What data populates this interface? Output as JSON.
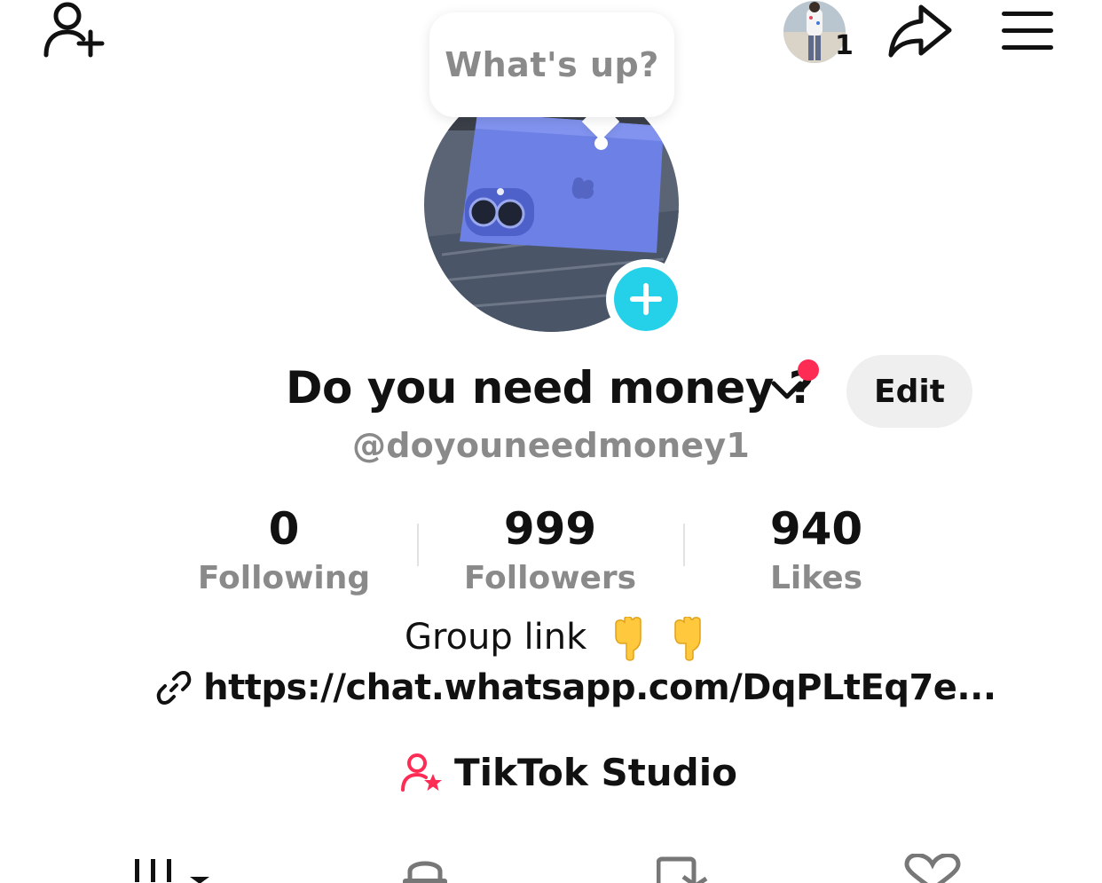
{
  "header": {
    "add_friend_icon": "add-user-icon",
    "notification_count": "1",
    "share_icon": "share-icon",
    "menu_icon": "hamburger-icon"
  },
  "bubble": {
    "text": "What's up?"
  },
  "profile": {
    "name": "Do you need money ?",
    "handle": "@doyouneedmoney1",
    "edit_label": "Edit"
  },
  "stats": [
    {
      "value": "0",
      "label": "Following"
    },
    {
      "value": "999",
      "label": "Followers"
    },
    {
      "value": "940",
      "label": "Likes"
    }
  ],
  "bio": {
    "line1": "Group link",
    "link": "https://chat.whatsapp.com/DqPLtEq7e..."
  },
  "studio": {
    "label": "TikTok Studio"
  },
  "colors": {
    "accent_cyan": "#25d0e9",
    "accent_red": "#fe2c55",
    "muted_text": "#8a8a8a"
  }
}
